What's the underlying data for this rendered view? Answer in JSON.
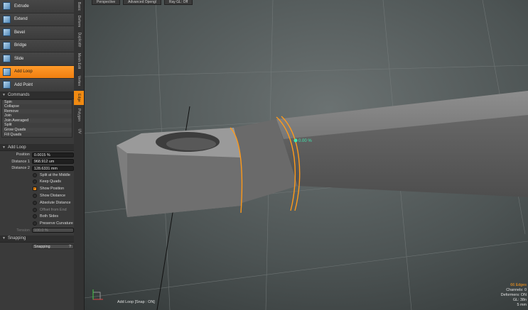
{
  "tools": [
    {
      "label": "Extrude",
      "active": false
    },
    {
      "label": "Extend",
      "active": false
    },
    {
      "label": "Bevel",
      "active": false
    },
    {
      "label": "Bridge",
      "active": false
    },
    {
      "label": "Slide",
      "active": false
    },
    {
      "label": "Add Loop",
      "active": true
    },
    {
      "label": "Add Point",
      "active": false
    }
  ],
  "commands": {
    "header": "Commands",
    "items": [
      "Spin",
      "Collapse",
      "Remove",
      "Join",
      "Join Averaged",
      "Split",
      "Grow Quads",
      "Fill Quads"
    ]
  },
  "properties": {
    "header": "Add Loop",
    "fields": [
      {
        "label": "Position",
        "value": "0.0015 %"
      },
      {
        "label": "Distance 1",
        "value": "968.912 um"
      },
      {
        "label": "Distance 2",
        "value": "128.6331 mm"
      }
    ],
    "checkboxes": [
      {
        "label": "Split at the Middle",
        "checked": false,
        "disabled": false
      },
      {
        "label": "Keep Quads",
        "checked": false,
        "disabled": false
      },
      {
        "label": "Show Position",
        "checked": true,
        "disabled": false
      },
      {
        "label": "Show Distance",
        "checked": false,
        "disabled": false
      },
      {
        "label": "Absolute Distance",
        "checked": false,
        "disabled": false
      },
      {
        "label": "Offset from End",
        "checked": false,
        "disabled": true
      },
      {
        "label": "Both Sides",
        "checked": false,
        "disabled": false
      },
      {
        "label": "Preserve Curvature",
        "checked": false,
        "disabled": false
      }
    ],
    "tension_label": "Tension",
    "tension_value": "100.0 %"
  },
  "snapping": {
    "header": "Snapping",
    "value": "Snapping"
  },
  "vertical_tabs": [
    {
      "label": "Basic",
      "active": false
    },
    {
      "label": "Deform",
      "active": false
    },
    {
      "label": "Duplicate",
      "active": false
    },
    {
      "label": "Mesh Edit",
      "active": false
    },
    {
      "label": "Vertex",
      "active": false
    },
    {
      "label": "Edge",
      "active": true
    },
    {
      "label": "Polygon",
      "active": false
    },
    {
      "label": "UV",
      "active": false
    }
  ],
  "viewport": {
    "header_buttons": [
      "Perspective",
      "Advanced Opengl",
      "Ray GL: Off"
    ],
    "handle_label": "0.00 %",
    "status_text": "Add Loop [Snap : ON]",
    "info": {
      "edges": "66 Edges",
      "channels": "Channels: 0",
      "deformers": "Deformers: ON",
      "gl": "GL: 38n",
      "size": "5 mm"
    }
  },
  "colors": {
    "accent": "#f08a12",
    "selection": "#ff9a1a",
    "handle": "#3ee8b0"
  }
}
